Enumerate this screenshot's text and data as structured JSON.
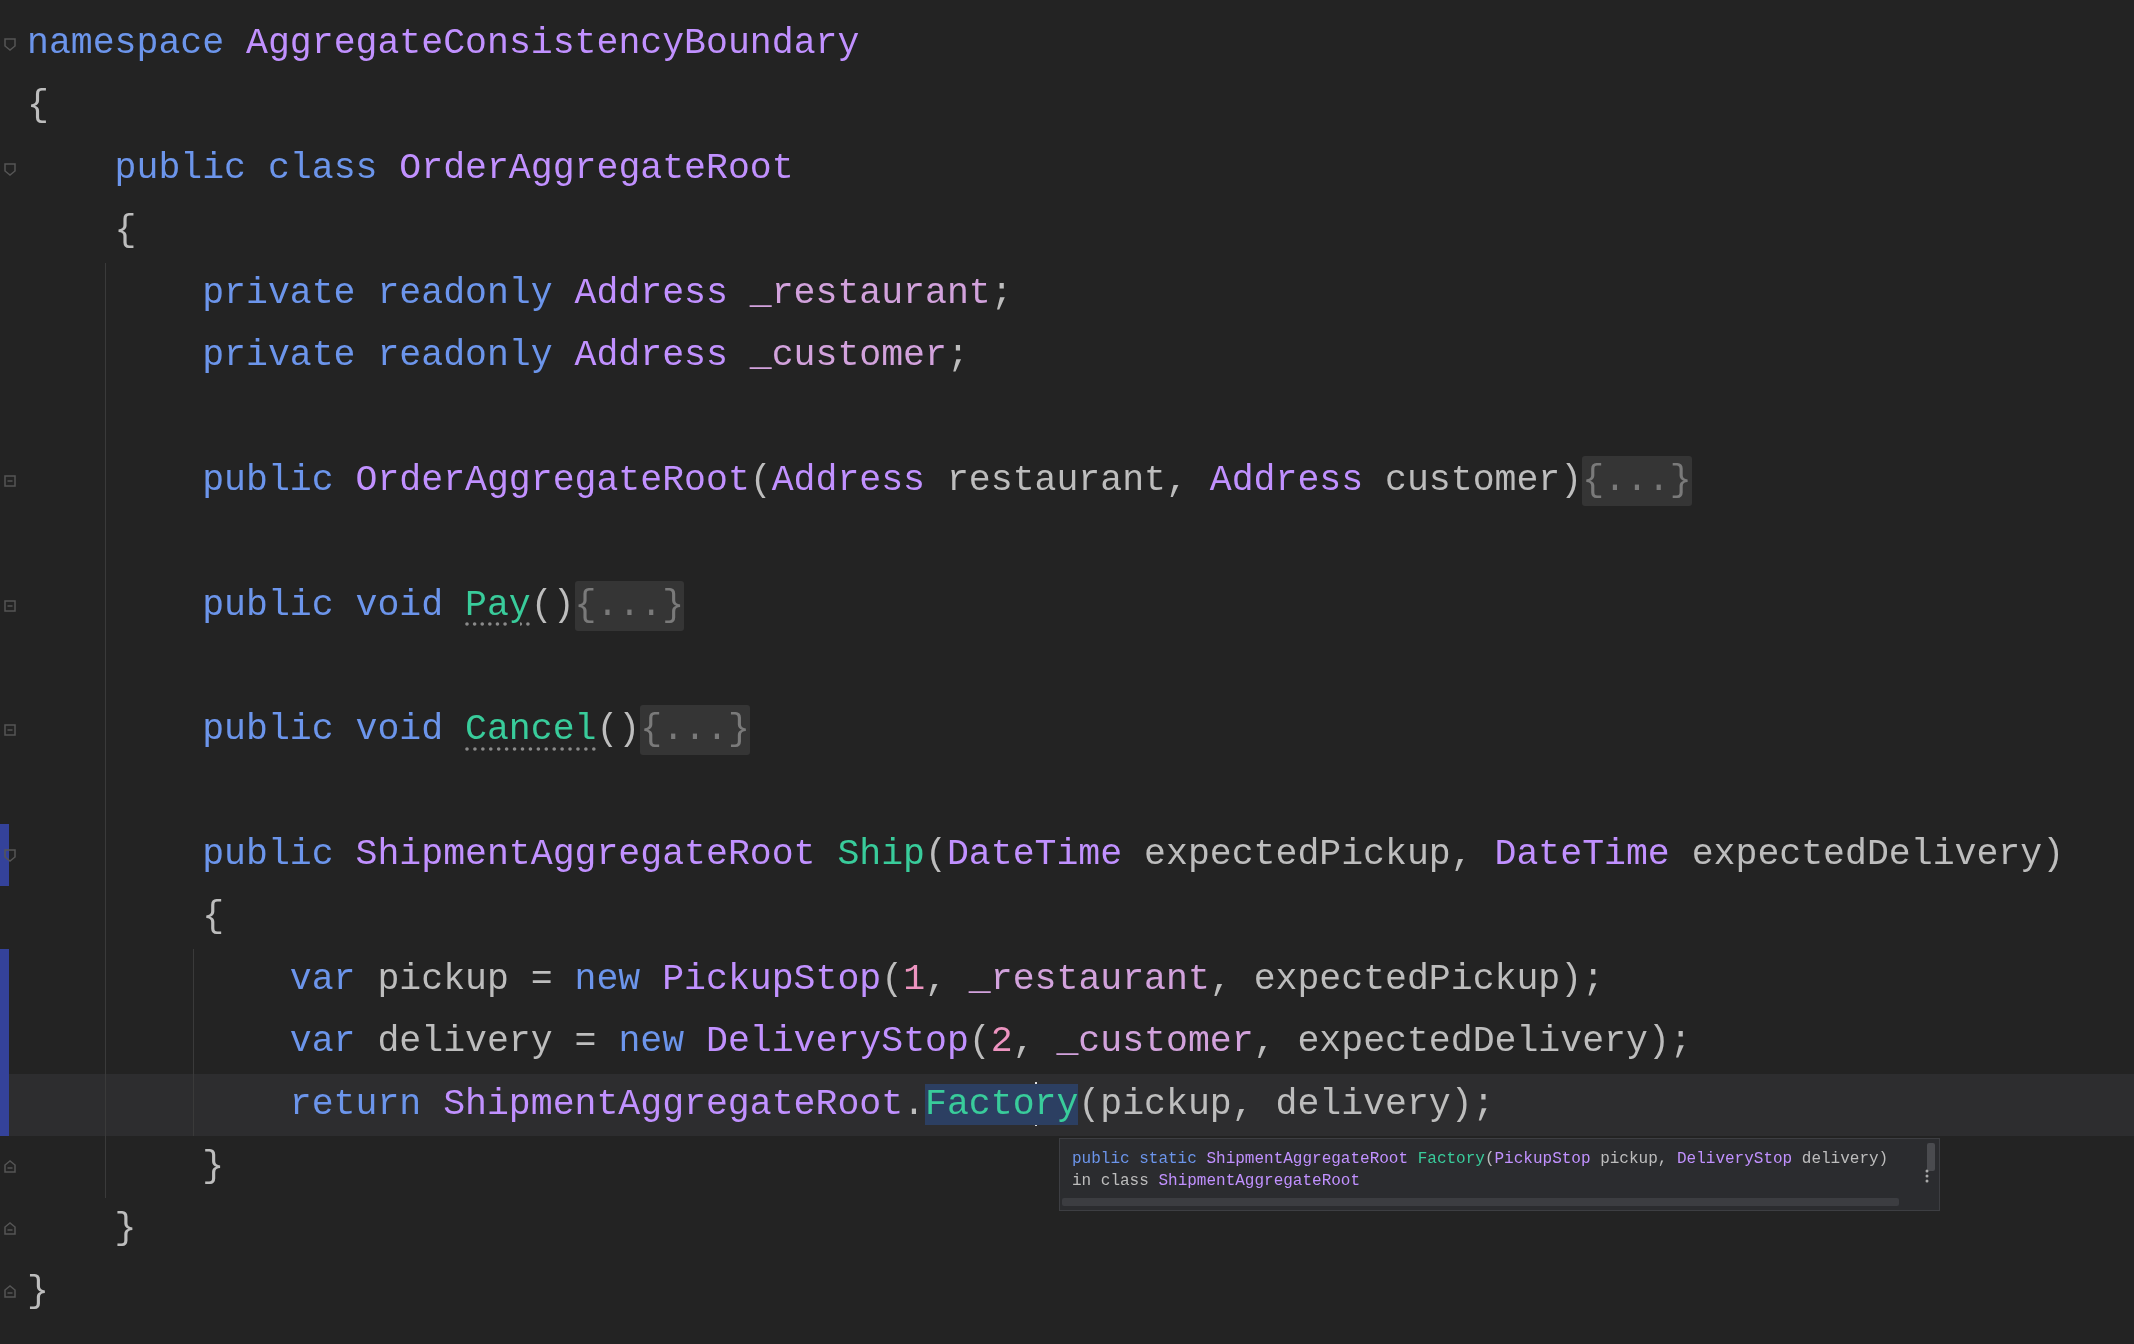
{
  "editor": {
    "lines": [
      {
        "kind": "code",
        "fold": {
          "kind": "start",
          "collapsed": false
        },
        "changed": false,
        "current": false,
        "tokens": [
          {
            "kind": "keyword",
            "text": "namespace"
          },
          {
            "kind": "type",
            "text": "AggregateConsistencyBoundary",
            "sp": true
          }
        ]
      },
      {
        "kind": "code",
        "changed": false,
        "current": false,
        "tokens": [
          {
            "kind": "plain",
            "text": "{"
          }
        ],
        "children": [
          {
            "kind": "code",
            "fold": {
              "kind": "start",
              "collapsed": false
            },
            "changed": false,
            "current": false,
            "tokens": [
              {
                "kind": "keyword",
                "text": "public class"
              },
              {
                "kind": "type",
                "text": "OrderAggregateRoot",
                "sp": true
              }
            ]
          },
          {
            "kind": "code",
            "changed": false,
            "current": false,
            "tokens": [
              {
                "kind": "plain",
                "text": "{"
              }
            ],
            "children": [
              {
                "kind": "code",
                "changed": false,
                "current": false,
                "tokens": [
                  {
                    "kind": "keyword",
                    "text": "private readonly"
                  },
                  {
                    "kind": "type",
                    "text": "Address",
                    "sp": true
                  },
                  {
                    "kind": "field",
                    "text": "_restaurant",
                    "sp": true
                  },
                  {
                    "kind": "plain",
                    "text": ";"
                  }
                ]
              },
              {
                "kind": "code",
                "changed": false,
                "current": false,
                "tokens": [
                  {
                    "kind": "keyword",
                    "text": "private readonly"
                  },
                  {
                    "kind": "type",
                    "text": "Address",
                    "sp": true
                  },
                  {
                    "kind": "field",
                    "text": "_customer",
                    "sp": true
                  },
                  {
                    "kind": "plain",
                    "text": ";"
                  }
                ]
              },
              {
                "kind": "blank",
                "changed": false,
                "current": false
              },
              {
                "kind": "code",
                "fold": {
                  "kind": "start",
                  "collapsed": true
                },
                "changed": false,
                "current": false,
                "tokens": [
                  {
                    "kind": "keyword",
                    "text": "public"
                  },
                  {
                    "kind": "type",
                    "text": "OrderAggregateRoot",
                    "sp": true
                  },
                  {
                    "kind": "plain",
                    "text": "("
                  },
                  {
                    "kind": "type",
                    "text": "Address"
                  },
                  {
                    "kind": "plain",
                    "text": "restaurant,",
                    "sp": true
                  },
                  {
                    "kind": "type",
                    "text": "Address",
                    "sp": true
                  },
                  {
                    "kind": "plain",
                    "text": "customer)",
                    "sp": true
                  },
                  {
                    "kind": "folded",
                    "text": "{...}"
                  }
                ]
              },
              {
                "kind": "blank",
                "changed": false,
                "current": false
              },
              {
                "kind": "code",
                "fold": {
                  "kind": "start",
                  "collapsed": true
                },
                "changed": false,
                "current": false,
                "tokens": [
                  {
                    "kind": "keyword",
                    "text": "public void"
                  },
                  {
                    "kind": "method",
                    "text": "Pay",
                    "sp": true,
                    "hint": true
                  },
                  {
                    "kind": "plain",
                    "text": "()"
                  },
                  {
                    "kind": "folded",
                    "text": "{...}"
                  }
                ]
              },
              {
                "kind": "blank",
                "changed": false,
                "current": false
              },
              {
                "kind": "code",
                "fold": {
                  "kind": "start",
                  "collapsed": true
                },
                "changed": false,
                "current": false,
                "tokens": [
                  {
                    "kind": "keyword",
                    "text": "public void"
                  },
                  {
                    "kind": "method",
                    "text": "Cancel",
                    "sp": true,
                    "hint": true
                  },
                  {
                    "kind": "plain",
                    "text": "()"
                  },
                  {
                    "kind": "folded",
                    "text": "{...}"
                  }
                ]
              },
              {
                "kind": "blank",
                "changed": false,
                "current": false
              },
              {
                "kind": "code",
                "fold": {
                  "kind": "start",
                  "collapsed": false
                },
                "changed": true,
                "current": false,
                "tokens": [
                  {
                    "kind": "keyword",
                    "text": "public"
                  },
                  {
                    "kind": "type",
                    "text": "ShipmentAggregateRoot",
                    "sp": true
                  },
                  {
                    "kind": "method",
                    "text": "Ship",
                    "sp": true
                  },
                  {
                    "kind": "plain",
                    "text": "("
                  },
                  {
                    "kind": "type",
                    "text": "DateTime"
                  },
                  {
                    "kind": "plain",
                    "text": "expectedPickup,",
                    "sp": true
                  },
                  {
                    "kind": "type",
                    "text": "DateTime",
                    "sp": true
                  },
                  {
                    "kind": "plain",
                    "text": "expectedDelivery)",
                    "sp": true
                  }
                ]
              },
              {
                "kind": "code",
                "changed": false,
                "current": false,
                "tokens": [
                  {
                    "kind": "plain",
                    "text": "{"
                  }
                ],
                "children": [
                  {
                    "kind": "code",
                    "changed": true,
                    "current": false,
                    "tokens": [
                      {
                        "kind": "keyword",
                        "text": "var"
                      },
                      {
                        "kind": "plain",
                        "text": "pickup =",
                        "sp": true
                      },
                      {
                        "kind": "keyword",
                        "text": "new",
                        "sp": true
                      },
                      {
                        "kind": "type",
                        "text": "PickupStop",
                        "sp": true
                      },
                      {
                        "kind": "plain",
                        "text": "("
                      },
                      {
                        "kind": "number",
                        "text": "1"
                      },
                      {
                        "kind": "plain",
                        "text": ","
                      },
                      {
                        "kind": "field",
                        "text": "_restaurant",
                        "sp": true
                      },
                      {
                        "kind": "plain",
                        "text": ","
                      },
                      {
                        "kind": "plain",
                        "text": "expectedPickup);",
                        "sp": true
                      }
                    ]
                  },
                  {
                    "kind": "code",
                    "changed": true,
                    "current": false,
                    "tokens": [
                      {
                        "kind": "keyword",
                        "text": "var"
                      },
                      {
                        "kind": "plain",
                        "text": "delivery =",
                        "sp": true
                      },
                      {
                        "kind": "keyword",
                        "text": "new",
                        "sp": true
                      },
                      {
                        "kind": "type",
                        "text": "DeliveryStop",
                        "sp": true
                      },
                      {
                        "kind": "plain",
                        "text": "("
                      },
                      {
                        "kind": "number",
                        "text": "2"
                      },
                      {
                        "kind": "plain",
                        "text": ","
                      },
                      {
                        "kind": "field",
                        "text": "_customer",
                        "sp": true
                      },
                      {
                        "kind": "plain",
                        "text": ","
                      },
                      {
                        "kind": "plain",
                        "text": "expectedDelivery);",
                        "sp": true
                      }
                    ]
                  },
                  {
                    "kind": "code",
                    "changed": true,
                    "current": true,
                    "tokens": [
                      {
                        "kind": "keyword",
                        "text": "return"
                      },
                      {
                        "kind": "type",
                        "text": "ShipmentAggregateRoot",
                        "sp": true
                      },
                      {
                        "kind": "plain",
                        "text": "."
                      },
                      {
                        "kind": "method",
                        "text": "Facto",
                        "highlighted": true
                      },
                      {
                        "kind": "caret"
                      },
                      {
                        "kind": "method",
                        "text": "ry",
                        "highlighted": true
                      },
                      {
                        "kind": "plain",
                        "text": "(pickup, delivery);"
                      }
                    ],
                    "tooltip": {
                      "lines": [
                        {
                          "tokens": [
                            {
                              "kind": "keyword",
                              "text": "public static"
                            },
                            {
                              "kind": "type",
                              "text": "ShipmentAggregateRoot",
                              "sp": true
                            },
                            {
                              "kind": "method",
                              "text": "Factory",
                              "sp": true
                            },
                            {
                              "kind": "plain",
                              "text": "("
                            },
                            {
                              "kind": "type",
                              "text": "PickupStop"
                            },
                            {
                              "kind": "plain",
                              "text": "pickup,",
                              "sp": true
                            },
                            {
                              "kind": "type",
                              "text": "DeliveryStop",
                              "sp": true
                            },
                            {
                              "kind": "plain",
                              "text": "delivery)",
                              "sp": true
                            }
                          ]
                        },
                        {
                          "tokens": [
                            {
                              "kind": "plain",
                              "text": "in class"
                            },
                            {
                              "kind": "type",
                              "text": "ShipmentAggregateRoot",
                              "sp": true
                            }
                          ]
                        }
                      ]
                    }
                  }
                ]
              },
              {
                "kind": "code",
                "fold": {
                  "kind": "end"
                },
                "changed": false,
                "current": false,
                "tokens": [
                  {
                    "kind": "plain",
                    "text": "}"
                  }
                ]
              }
            ]
          },
          {
            "kind": "code",
            "fold": {
              "kind": "end"
            },
            "changed": false,
            "current": false,
            "tokens": [
              {
                "kind": "plain",
                "text": "}"
              }
            ]
          }
        ]
      },
      {
        "kind": "code",
        "fold": {
          "kind": "end"
        },
        "changed": false,
        "current": false,
        "tokens": [
          {
            "kind": "plain",
            "text": "}"
          }
        ]
      }
    ]
  }
}
